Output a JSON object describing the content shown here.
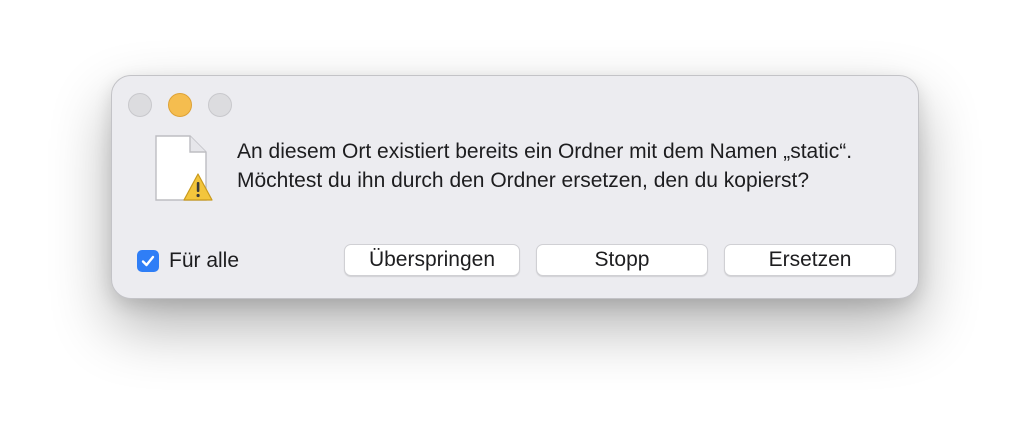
{
  "dialog": {
    "message": "An diesem Ort existiert bereits ein Ordner mit dem Namen „static“. Möchtest du ihn durch den Ordner ersetzen, den du kopierst?",
    "icon": "document-warning-icon"
  },
  "checkbox": {
    "label": "Für alle",
    "checked": true
  },
  "buttons": {
    "skip": "Überspringen",
    "stop": "Stopp",
    "replace": "Ersetzen"
  },
  "colors": {
    "accent": "#2f7ef6",
    "minimize": "#f5bd4f",
    "dialog_bg": "#ececf0"
  }
}
